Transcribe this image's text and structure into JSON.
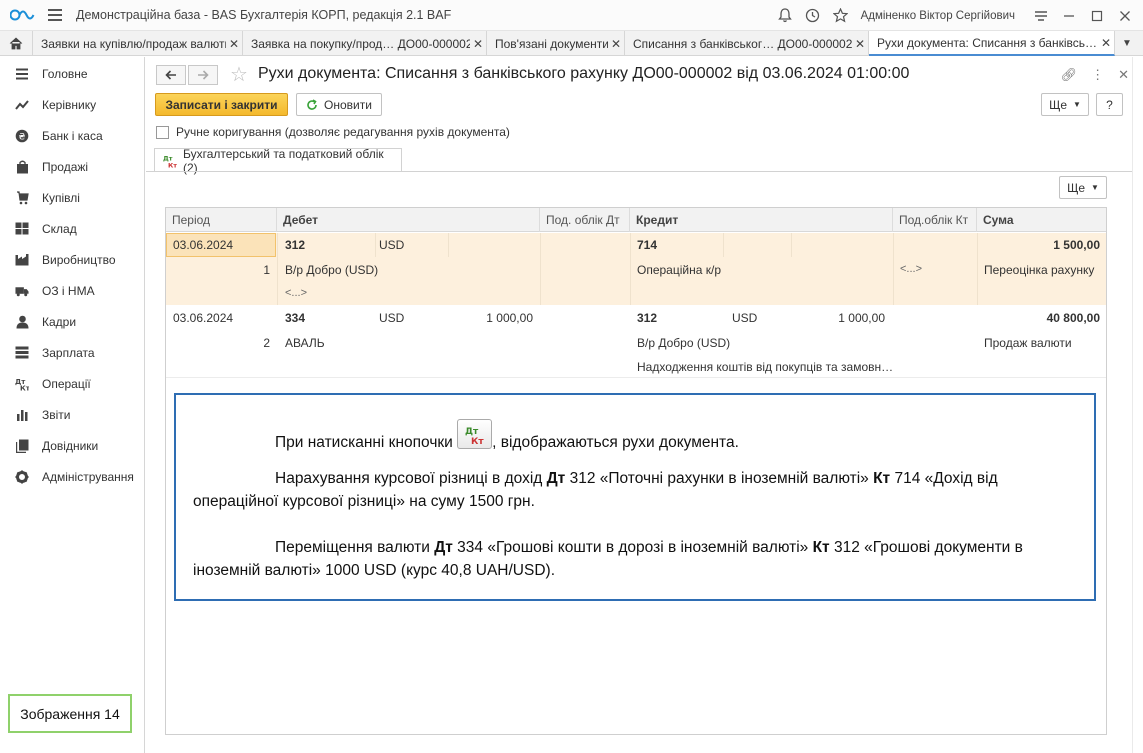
{
  "window": {
    "title": "Демонстраційна база - BAS Бухгалтерія КОРП, редакція 2.1 BAF",
    "user": "Адміненко Віктор Сергійович"
  },
  "tabs": [
    {
      "label": "Заявки на купівлю/продаж валюти"
    },
    {
      "label": "Заявка на покупку/прод…  ДО00-000002"
    },
    {
      "label": "Пов'язані документи"
    },
    {
      "label": "Списання з банківськог…  ДО00-000002"
    },
    {
      "label": "Рухи документа: Списання з банківсь…"
    }
  ],
  "sidebar": {
    "items": [
      {
        "label": "Головне",
        "icon": "menu-icon"
      },
      {
        "label": "Керівнику",
        "icon": "trend-icon"
      },
      {
        "label": "Банк і каса",
        "icon": "coin-icon"
      },
      {
        "label": "Продажі",
        "icon": "bag-icon"
      },
      {
        "label": "Купівлі",
        "icon": "cart-icon"
      },
      {
        "label": "Склад",
        "icon": "warehouse-icon"
      },
      {
        "label": "Виробництво",
        "icon": "factory-icon"
      },
      {
        "label": "ОЗ і НМА",
        "icon": "truck-icon"
      },
      {
        "label": "Кадри",
        "icon": "person-icon"
      },
      {
        "label": "Зарплата",
        "icon": "payroll-icon"
      },
      {
        "label": "Операції",
        "icon": "dtkt-icon"
      },
      {
        "label": "Звіти",
        "icon": "chart-icon"
      },
      {
        "label": "Довідники",
        "icon": "books-icon"
      },
      {
        "label": "Адміністрування",
        "icon": "gear-icon"
      }
    ],
    "image_note": "Зображення 14"
  },
  "form": {
    "title": "Рухи документа: Списання з банківського рахунку ДО00-000002 від 03.06.2024 01:00:00",
    "save_close": "Записати і закрити",
    "refresh": "Оновити",
    "more": "Ще",
    "help": "?",
    "manual_edit": "Ручне коригування (дозволяє редагування рухів документа)",
    "inner_tab": "Бухгалтерський та податковий облік (2)",
    "table_more": "Ще"
  },
  "table": {
    "headers": {
      "period": "Період",
      "debit": "Дебет",
      "tax_dt": "Под. облік Дт",
      "credit": "Кредит",
      "tax_kt": "Под.облік Кт",
      "sum": "Сума"
    },
    "rows": [
      {
        "date": "03.06.2024",
        "num": "1",
        "dt_account": "312",
        "dt_currency": "USD",
        "dt_amount": "",
        "dt_sub1": "В/р Добро (USD)",
        "dt_sub2": "<...>",
        "kt_account": "714",
        "kt_currency": "",
        "kt_amount": "",
        "kt_sub1": "Операційна к/р",
        "kt_sub2": "",
        "tax_kt": "<...>",
        "sum": "1 500,00",
        "content": "Переоцінка рахунку"
      },
      {
        "date": "03.06.2024",
        "num": "2",
        "dt_account": "334",
        "dt_currency": "USD",
        "dt_amount": "1 000,00",
        "dt_sub1": "АВАЛЬ",
        "dt_sub2": "",
        "kt_account": "312",
        "kt_currency": "USD",
        "kt_amount": "1 000,00",
        "kt_sub1": "В/р Добро (USD)",
        "kt_sub2": "Надходження коштів від покупців та замовн…",
        "tax_kt": "",
        "sum": "40 800,00",
        "content": "Продаж валюти"
      }
    ]
  },
  "note": {
    "p1_before": "При натисканні кнопочки ",
    "p1_after": ", відображаються рухи документа.",
    "p2_a": "Нарахування курсової різниці в дохід  ",
    "p2_dt": "Дт",
    "p2_b": " 312 «Поточні рахунки в іноземній валюті» ",
    "p2_kt": "Кт",
    "p2_c": " 714 «Дохід від операційної курсової різниці» на суму 1500 грн.",
    "p3_a": "Переміщення валюти ",
    "p3_dt": "Дт",
    "p3_b": " 334 «Грошові кошти в дорозі в іноземній валюті» ",
    "p3_kt": "Кт",
    "p3_c": " 312 «Грошові документи в іноземній валюті» 1000 USD (курс 40,8 UAH/USD)."
  },
  "colors": {
    "accent": "#4a8cd2",
    "primary_button": "#f4b92d",
    "selected_row": "#fdf0dd",
    "note_border": "#2e6db3",
    "image_note_border": "#8fd16b"
  }
}
